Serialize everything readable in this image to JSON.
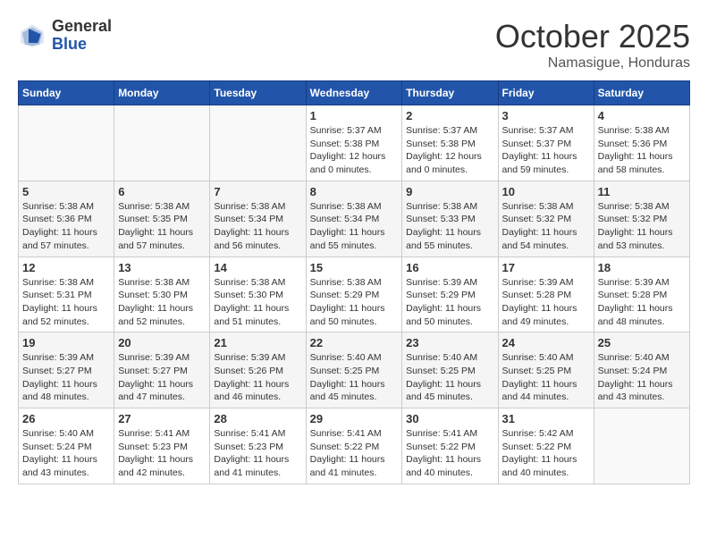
{
  "header": {
    "logo": {
      "general": "General",
      "blue": "Blue"
    },
    "month": "October 2025",
    "location": "Namasigue, Honduras"
  },
  "weekdays": [
    "Sunday",
    "Monday",
    "Tuesday",
    "Wednesday",
    "Thursday",
    "Friday",
    "Saturday"
  ],
  "weeks": [
    [
      {
        "day": "",
        "info": ""
      },
      {
        "day": "",
        "info": ""
      },
      {
        "day": "",
        "info": ""
      },
      {
        "day": "1",
        "info": "Sunrise: 5:37 AM\nSunset: 5:38 PM\nDaylight: 12 hours\nand 0 minutes."
      },
      {
        "day": "2",
        "info": "Sunrise: 5:37 AM\nSunset: 5:38 PM\nDaylight: 12 hours\nand 0 minutes."
      },
      {
        "day": "3",
        "info": "Sunrise: 5:37 AM\nSunset: 5:37 PM\nDaylight: 11 hours\nand 59 minutes."
      },
      {
        "day": "4",
        "info": "Sunrise: 5:38 AM\nSunset: 5:36 PM\nDaylight: 11 hours\nand 58 minutes."
      }
    ],
    [
      {
        "day": "5",
        "info": "Sunrise: 5:38 AM\nSunset: 5:36 PM\nDaylight: 11 hours\nand 57 minutes."
      },
      {
        "day": "6",
        "info": "Sunrise: 5:38 AM\nSunset: 5:35 PM\nDaylight: 11 hours\nand 57 minutes."
      },
      {
        "day": "7",
        "info": "Sunrise: 5:38 AM\nSunset: 5:34 PM\nDaylight: 11 hours\nand 56 minutes."
      },
      {
        "day": "8",
        "info": "Sunrise: 5:38 AM\nSunset: 5:34 PM\nDaylight: 11 hours\nand 55 minutes."
      },
      {
        "day": "9",
        "info": "Sunrise: 5:38 AM\nSunset: 5:33 PM\nDaylight: 11 hours\nand 55 minutes."
      },
      {
        "day": "10",
        "info": "Sunrise: 5:38 AM\nSunset: 5:32 PM\nDaylight: 11 hours\nand 54 minutes."
      },
      {
        "day": "11",
        "info": "Sunrise: 5:38 AM\nSunset: 5:32 PM\nDaylight: 11 hours\nand 53 minutes."
      }
    ],
    [
      {
        "day": "12",
        "info": "Sunrise: 5:38 AM\nSunset: 5:31 PM\nDaylight: 11 hours\nand 52 minutes."
      },
      {
        "day": "13",
        "info": "Sunrise: 5:38 AM\nSunset: 5:30 PM\nDaylight: 11 hours\nand 52 minutes."
      },
      {
        "day": "14",
        "info": "Sunrise: 5:38 AM\nSunset: 5:30 PM\nDaylight: 11 hours\nand 51 minutes."
      },
      {
        "day": "15",
        "info": "Sunrise: 5:38 AM\nSunset: 5:29 PM\nDaylight: 11 hours\nand 50 minutes."
      },
      {
        "day": "16",
        "info": "Sunrise: 5:39 AM\nSunset: 5:29 PM\nDaylight: 11 hours\nand 50 minutes."
      },
      {
        "day": "17",
        "info": "Sunrise: 5:39 AM\nSunset: 5:28 PM\nDaylight: 11 hours\nand 49 minutes."
      },
      {
        "day": "18",
        "info": "Sunrise: 5:39 AM\nSunset: 5:28 PM\nDaylight: 11 hours\nand 48 minutes."
      }
    ],
    [
      {
        "day": "19",
        "info": "Sunrise: 5:39 AM\nSunset: 5:27 PM\nDaylight: 11 hours\nand 48 minutes."
      },
      {
        "day": "20",
        "info": "Sunrise: 5:39 AM\nSunset: 5:27 PM\nDaylight: 11 hours\nand 47 minutes."
      },
      {
        "day": "21",
        "info": "Sunrise: 5:39 AM\nSunset: 5:26 PM\nDaylight: 11 hours\nand 46 minutes."
      },
      {
        "day": "22",
        "info": "Sunrise: 5:40 AM\nSunset: 5:25 PM\nDaylight: 11 hours\nand 45 minutes."
      },
      {
        "day": "23",
        "info": "Sunrise: 5:40 AM\nSunset: 5:25 PM\nDaylight: 11 hours\nand 45 minutes."
      },
      {
        "day": "24",
        "info": "Sunrise: 5:40 AM\nSunset: 5:25 PM\nDaylight: 11 hours\nand 44 minutes."
      },
      {
        "day": "25",
        "info": "Sunrise: 5:40 AM\nSunset: 5:24 PM\nDaylight: 11 hours\nand 43 minutes."
      }
    ],
    [
      {
        "day": "26",
        "info": "Sunrise: 5:40 AM\nSunset: 5:24 PM\nDaylight: 11 hours\nand 43 minutes."
      },
      {
        "day": "27",
        "info": "Sunrise: 5:41 AM\nSunset: 5:23 PM\nDaylight: 11 hours\nand 42 minutes."
      },
      {
        "day": "28",
        "info": "Sunrise: 5:41 AM\nSunset: 5:23 PM\nDaylight: 11 hours\nand 41 minutes."
      },
      {
        "day": "29",
        "info": "Sunrise: 5:41 AM\nSunset: 5:22 PM\nDaylight: 11 hours\nand 41 minutes."
      },
      {
        "day": "30",
        "info": "Sunrise: 5:41 AM\nSunset: 5:22 PM\nDaylight: 11 hours\nand 40 minutes."
      },
      {
        "day": "31",
        "info": "Sunrise: 5:42 AM\nSunset: 5:22 PM\nDaylight: 11 hours\nand 40 minutes."
      },
      {
        "day": "",
        "info": ""
      }
    ]
  ]
}
